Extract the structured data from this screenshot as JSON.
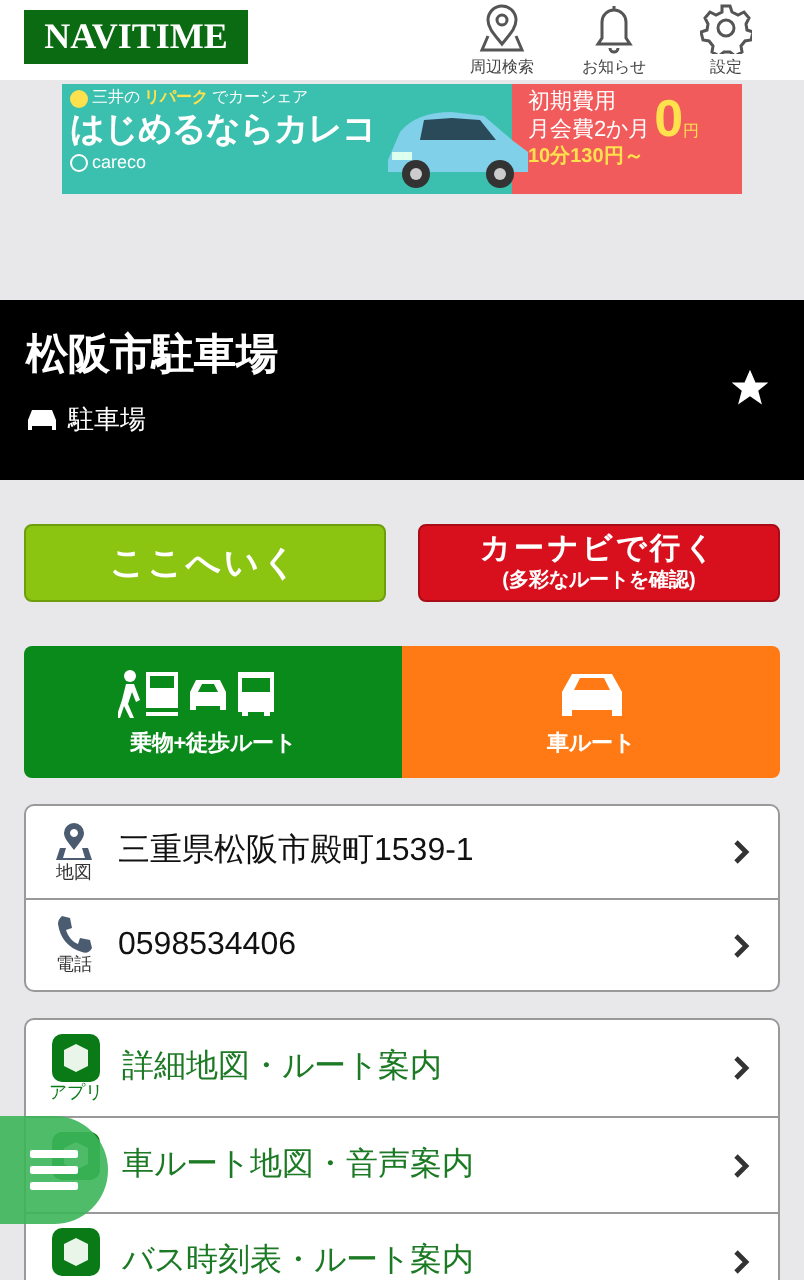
{
  "header": {
    "logo": "NAVITIME",
    "nav": [
      {
        "kind": "pin",
        "label": "周辺検索"
      },
      {
        "kind": "bell",
        "label": "お知らせ"
      },
      {
        "kind": "gear",
        "label": "設定"
      }
    ]
  },
  "ad": {
    "brand_small": "三井の",
    "brand": "リパーク",
    "brand_tail": "でカーシェア",
    "headline": "はじめるならカレコ",
    "logo": "careco",
    "offer_line1": "初期費用",
    "offer_line2": "月会費2か月",
    "offer_big": "0",
    "offer_unit": "円",
    "price": "10分130円～"
  },
  "place": {
    "title": "松阪市駐車場",
    "category": "駐車場",
    "favorite": true
  },
  "actions": [
    {
      "kind": "go",
      "label": "ここへいく"
    },
    {
      "kind": "carnavi",
      "label": "カーナビで行く",
      "sub": "(多彩なルートを確認)"
    }
  ],
  "routes": [
    {
      "kind": "transit",
      "label": "乗物+徒歩ルート"
    },
    {
      "kind": "car",
      "label": "車ルート"
    }
  ],
  "info": [
    {
      "kind": "map",
      "icon_label": "地図",
      "text": "三重県松阪市殿町1539-1"
    },
    {
      "kind": "phone",
      "icon_label": "電話",
      "text": "0598534406"
    }
  ],
  "apps": [
    {
      "icon_label": "アプリ",
      "text": "詳細地図・ルート案内"
    },
    {
      "text": "車ルート地図・音声案内"
    },
    {
      "text": "バス時刻表・ルート案内"
    }
  ]
}
